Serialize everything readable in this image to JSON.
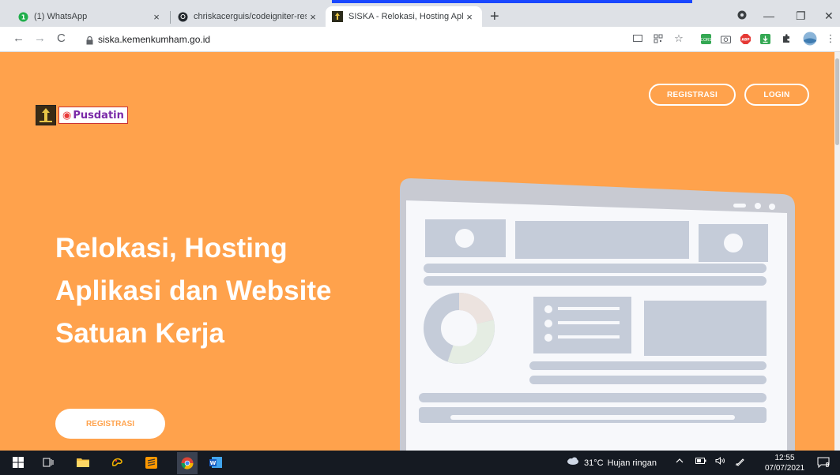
{
  "browser": {
    "tabs": [
      {
        "title": "(1) WhatsApp",
        "close": "×"
      },
      {
        "title": "chriskacerguis/codeigniter-restse",
        "close": "×"
      },
      {
        "title": "SISKA - Relokasi, Hosting Aplikas",
        "close": "×"
      }
    ],
    "new_tab": "+",
    "window_controls": {
      "minimize": "—",
      "restore": "❐",
      "close": "✕"
    },
    "nav": {
      "back": "←",
      "forward": "→",
      "reload": "C"
    },
    "url": "siska.kemenkumham.go.id",
    "whatsapp_badge": "1"
  },
  "page": {
    "logo_text": "Pusdatin",
    "nav": {
      "register": "REGISTRASI",
      "login": "LOGIN"
    },
    "hero_title": "Relokasi, Hosting Aplikasi dan Website Satuan Kerja",
    "hero_button": "REGISTRASI"
  },
  "taskbar": {
    "weather_temp": "31°C",
    "weather_condition": "Hujan ringan",
    "time": "12:55",
    "date": "07/07/2021",
    "notification_count": "8"
  },
  "colors": {
    "brand_orange": "#ffa24c",
    "illustration_gray": "#c5ccd9",
    "taskbar": "#151a22"
  }
}
